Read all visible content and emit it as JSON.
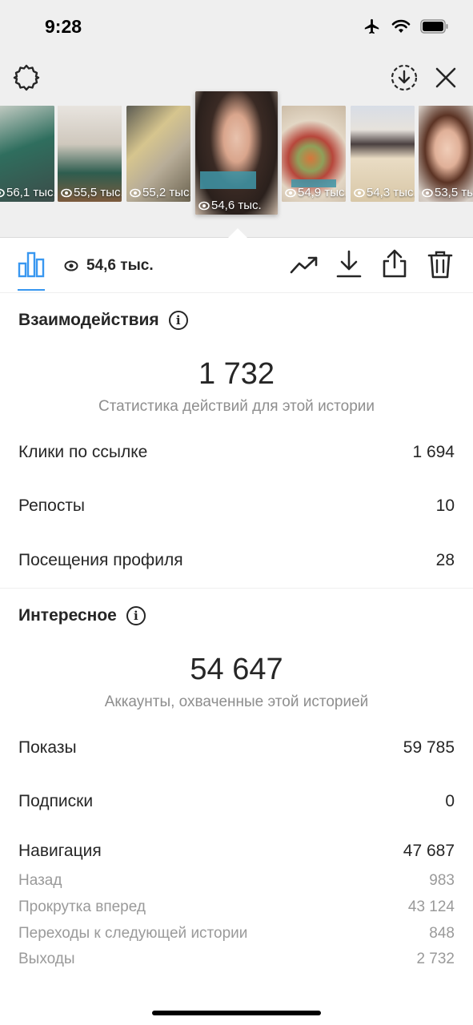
{
  "status_bar": {
    "time": "9:28"
  },
  "story_strip": {
    "thumbnails": [
      {
        "views": "56,1 тыс.",
        "active": false,
        "bg": "#5a7a6e"
      },
      {
        "views": "55,5 тыс.",
        "active": false,
        "bg": "#b9b0a5"
      },
      {
        "views": "55,2 тыс.",
        "active": false,
        "bg": "#a79a84"
      },
      {
        "views": "54,6 тыс.",
        "active": true,
        "bg": "#8a6a5c"
      },
      {
        "views": "54,9 тыс.",
        "active": false,
        "bg": "#c9a98a"
      },
      {
        "views": "54,3 тыс.",
        "active": false,
        "bg": "#d9cdb7"
      },
      {
        "views": "53,5 тыс.",
        "active": false,
        "bg": "#9c7a68"
      }
    ]
  },
  "toolbar": {
    "views_total": "54,6 тыс."
  },
  "interactions": {
    "title": "Взаимодействия",
    "total": "1 732",
    "subtitle": "Статистика действий для этой истории",
    "rows": [
      {
        "label": "Клики по ссылке",
        "value": "1 694"
      },
      {
        "label": "Репосты",
        "value": "10"
      },
      {
        "label": "Посещения профиля",
        "value": "28"
      }
    ]
  },
  "discovery": {
    "title": "Интересное",
    "total": "54 647",
    "subtitle": "Аккаунты, охваченные этой историей",
    "rows": [
      {
        "label": "Показы",
        "value": "59 785"
      },
      {
        "label": "Подписки",
        "value": "0"
      },
      {
        "label": "Навигация",
        "value": "47 687"
      }
    ],
    "navigation": [
      {
        "label": "Назад",
        "value": "983"
      },
      {
        "label": "Прокрутка вперед",
        "value": "43 124"
      },
      {
        "label": "Переходы к следующей истории",
        "value": "848"
      },
      {
        "label": "Выходы",
        "value": "2 732"
      }
    ]
  },
  "colors": {
    "accent": "#3897f0",
    "muted": "#8e8e8e",
    "panel": "#efefef"
  },
  "icons": [
    "settings-icon",
    "download-circle-icon",
    "close-icon",
    "insights-icon",
    "eye-icon",
    "trending-icon",
    "save-icon",
    "share-icon",
    "delete-icon"
  ]
}
